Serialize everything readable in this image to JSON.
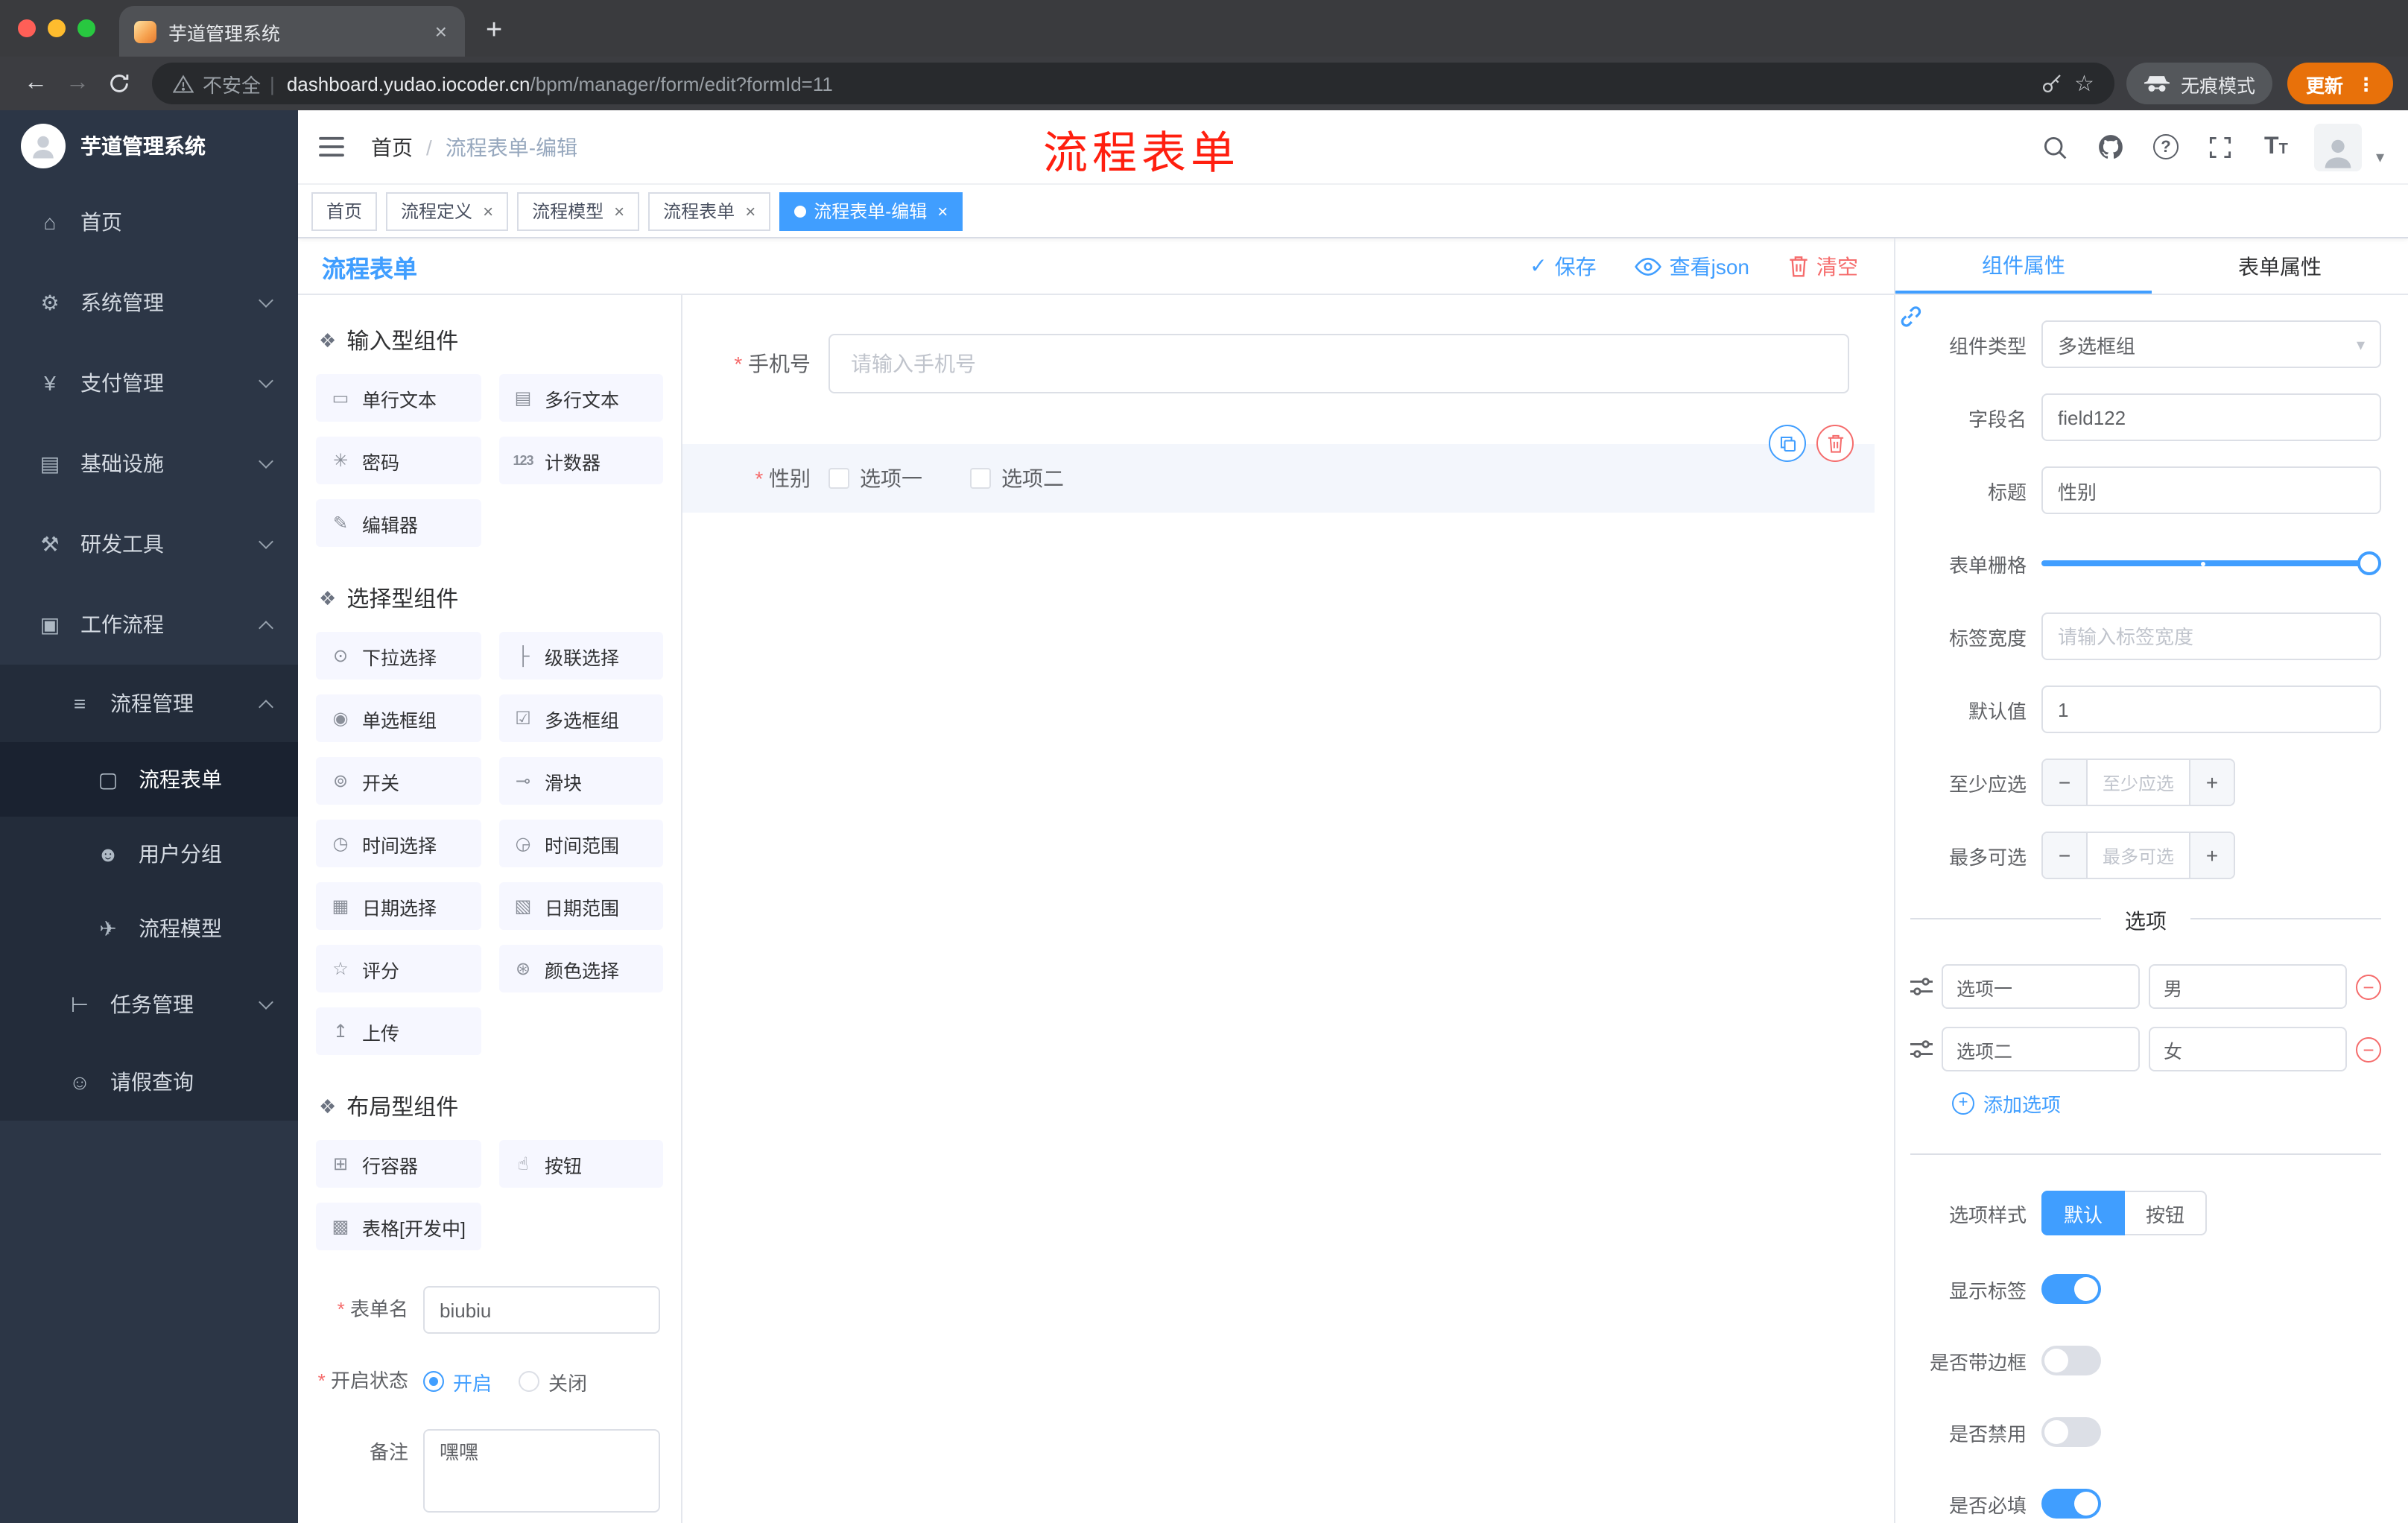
{
  "browser": {
    "tab_title": "芋道管理系统",
    "security_label": "不安全",
    "url_domain": "dashboard.yudao.iocoder.cn",
    "url_path": "/bpm/manager/form/edit?formId=11",
    "incognito_label": "无痕模式",
    "update_label": "更新"
  },
  "sidebar": {
    "logo_title": "芋道管理系统",
    "items": [
      {
        "label": "首页",
        "icon": "home-icon"
      },
      {
        "label": "系统管理",
        "icon": "gear-icon",
        "expandable": true
      },
      {
        "label": "支付管理",
        "icon": "payment-icon",
        "expandable": true
      },
      {
        "label": "基础设施",
        "icon": "infrastructure-icon",
        "expandable": true
      },
      {
        "label": "研发工具",
        "icon": "devtools-icon",
        "expandable": true
      },
      {
        "label": "工作流程",
        "icon": "workflow-icon",
        "expandable": true,
        "expanded": true
      },
      {
        "label": "流程管理",
        "icon": "process-icon",
        "level": 2,
        "expanded": true
      },
      {
        "label": "流程表单",
        "icon": "form-icon",
        "level": 3,
        "active": true
      },
      {
        "label": "用户分组",
        "icon": "usergroup-icon",
        "level": 3
      },
      {
        "label": "流程模型",
        "icon": "model-icon",
        "level": 3
      },
      {
        "label": "任务管理",
        "icon": "task-icon",
        "level": 2,
        "expandable": true
      },
      {
        "label": "请假查询",
        "icon": "person-icon",
        "level": 2
      }
    ]
  },
  "header": {
    "breadcrumb_home": "首页",
    "breadcrumb_sep": "/",
    "breadcrumb_current": "流程表单-编辑",
    "annotation": "流程表单"
  },
  "tags": [
    {
      "label": "首页",
      "closable": false,
      "active": false
    },
    {
      "label": "流程定义",
      "closable": true,
      "active": false
    },
    {
      "label": "流程模型",
      "closable": true,
      "active": false
    },
    {
      "label": "流程表单",
      "closable": true,
      "active": false
    },
    {
      "label": "流程表单-编辑",
      "closable": true,
      "active": true
    }
  ],
  "designer": {
    "title": "流程表单",
    "save_label": "保存",
    "view_json_label": "查看json",
    "clear_label": "清空"
  },
  "palette": {
    "groups": [
      {
        "title": "输入型组件",
        "items": [
          {
            "label": "单行文本",
            "icon": "text-input-icon"
          },
          {
            "label": "多行文本",
            "icon": "textarea-icon"
          },
          {
            "label": "密码",
            "icon": "password-icon"
          },
          {
            "label": "计数器",
            "icon": "counter-icon"
          },
          {
            "label": "编辑器",
            "icon": "editor-icon"
          }
        ]
      },
      {
        "title": "选择型组件",
        "items": [
          {
            "label": "下拉选择",
            "icon": "select-icon"
          },
          {
            "label": "级联选择",
            "icon": "cascader-icon"
          },
          {
            "label": "单选框组",
            "icon": "radio-group-icon"
          },
          {
            "label": "多选框组",
            "icon": "checkbox-group-icon"
          },
          {
            "label": "开关",
            "icon": "switch-icon"
          },
          {
            "label": "滑块",
            "icon": "slider-icon"
          },
          {
            "label": "时间选择",
            "icon": "time-picker-icon"
          },
          {
            "label": "时间范围",
            "icon": "time-range-icon"
          },
          {
            "label": "日期选择",
            "icon": "date-picker-icon"
          },
          {
            "label": "日期范围",
            "icon": "date-range-icon"
          },
          {
            "label": "评分",
            "icon": "rate-icon"
          },
          {
            "label": "颜色选择",
            "icon": "color-picker-icon"
          },
          {
            "label": "上传",
            "icon": "upload-icon"
          }
        ]
      },
      {
        "title": "布局型组件",
        "items": [
          {
            "label": "行容器",
            "icon": "row-container-icon"
          },
          {
            "label": "按钮",
            "icon": "button-icon"
          },
          {
            "label": "表格[开发中]",
            "icon": "table-icon"
          }
        ]
      }
    ]
  },
  "form_config": {
    "name_label": "表单名",
    "name_value": "biubiu",
    "status_label": "开启状态",
    "status_on": "开启",
    "status_off": "关闭",
    "status_selected": "开启",
    "remark_label": "备注",
    "remark_value": "嘿嘿"
  },
  "canvas": {
    "phone_label": "手机号",
    "phone_required": true,
    "phone_placeholder": "请输入手机号",
    "gender_label": "性别",
    "gender_required": true,
    "gender_options": [
      "选项一",
      "选项二"
    ]
  },
  "properties": {
    "tab_component": "组件属性",
    "tab_form": "表单属性",
    "component_type_label": "组件类型",
    "component_type_value": "多选框组",
    "field_name_label": "字段名",
    "field_name_value": "field122",
    "title_label": "标题",
    "title_value": "性别",
    "grid_label": "表单栅格",
    "label_width_label": "标签宽度",
    "label_width_placeholder": "请输入标签宽度",
    "default_label": "默认值",
    "default_value": "1",
    "min_label": "至少应选",
    "min_placeholder": "至少应选",
    "max_label": "最多可选",
    "max_placeholder": "最多可选",
    "options_title": "选项",
    "options": [
      {
        "name": "选项一",
        "value": "男"
      },
      {
        "name": "选项二",
        "value": "女"
      }
    ],
    "add_option_label": "添加选项",
    "style_label": "选项样式",
    "style_default": "默认",
    "style_button": "按钮",
    "style_selected": "默认",
    "switches": [
      {
        "label": "显示标签",
        "on": true
      },
      {
        "label": "是否带边框",
        "on": false
      },
      {
        "label": "是否禁用",
        "on": false
      },
      {
        "label": "是否必填",
        "on": true
      }
    ]
  },
  "colors": {
    "accent": "#409eff",
    "danger": "#f56c6c",
    "annotation_red": "#ff1f0f",
    "sidebar_bg": "#2c3646",
    "active_tag_bg": "#409eff"
  }
}
